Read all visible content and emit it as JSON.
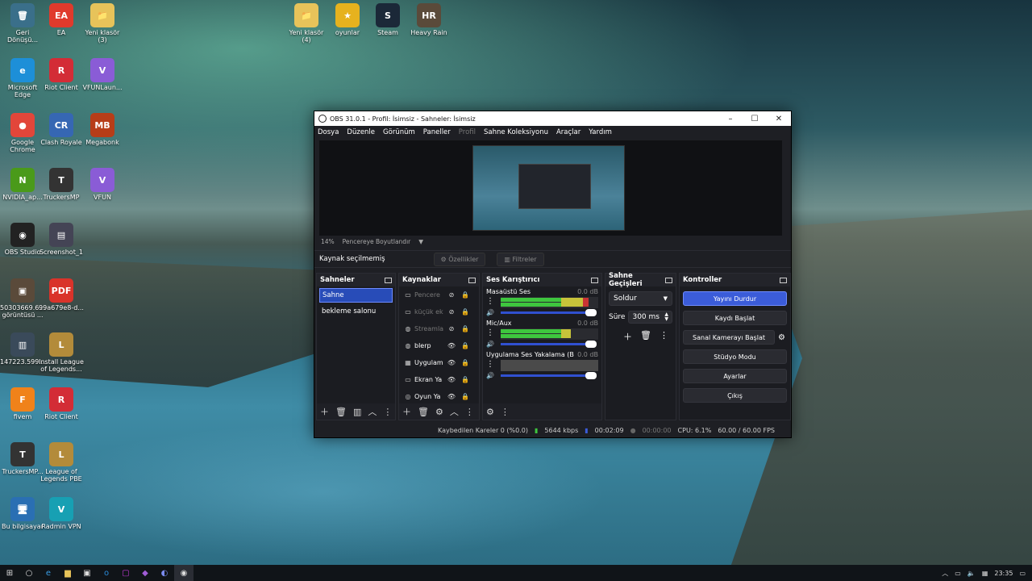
{
  "desktop": {
    "icons": [
      {
        "label": "Geri Dönüşü...",
        "icon": "recycle-bin-icon",
        "glyph": "🗑",
        "bg": "#3a6f8a"
      },
      {
        "label": "EA",
        "icon": "ea-icon",
        "glyph": "EA",
        "bg": "#e03a2c"
      },
      {
        "label": "Yeni klasör (3)",
        "icon": "folder-icon",
        "glyph": "📁",
        "bg": "#e7c35a"
      },
      {
        "label": "Microsoft Edge",
        "icon": "edge-icon",
        "glyph": "e",
        "bg": "#1d8fd8"
      },
      {
        "label": "Riot Client",
        "icon": "riot-icon",
        "glyph": "R",
        "bg": "#d32c36"
      },
      {
        "label": "VFUNLaun...",
        "icon": "vfun-launcher-icon",
        "glyph": "V",
        "bg": "#8a5cd6"
      },
      {
        "label": "Google Chrome",
        "icon": "chrome-icon",
        "glyph": "●",
        "bg": "#e2463a"
      },
      {
        "label": "Clash Royale",
        "icon": "clash-royale-icon",
        "glyph": "CR",
        "bg": "#3667b3"
      },
      {
        "label": "Megabonk",
        "icon": "megabonk-icon",
        "glyph": "MB",
        "bg": "#b73d18"
      },
      {
        "label": "NVIDIA_ap...",
        "icon": "nvidia-icon",
        "glyph": "N",
        "bg": "#4a9a1a"
      },
      {
        "label": "TruckersMP",
        "icon": "truckersmp-icon",
        "glyph": "T",
        "bg": "#333"
      },
      {
        "label": "VFUN",
        "icon": "vfun-icon",
        "glyph": "V",
        "bg": "#8a5cd6"
      },
      {
        "label": "OBS Studio",
        "icon": "obs-icon",
        "glyph": "◉",
        "bg": "#222"
      },
      {
        "label": "Screenshot_1",
        "icon": "screenshot-icon",
        "glyph": "▤",
        "bg": "#445"
      },
      {
        "label": "50303669.6... görüntüsü ...",
        "icon": "image-file-icon",
        "glyph": "▣",
        "bg": "#5a4a3a"
      },
      {
        "label": "99a679e8-d...",
        "icon": "pdf-icon",
        "glyph": "PDF",
        "bg": "#d9332a"
      },
      {
        "label": "147223.599...",
        "icon": "file-icon",
        "glyph": "▥",
        "bg": "#3a4a5a"
      },
      {
        "label": "Install League of Legends...",
        "icon": "league-install-icon",
        "glyph": "L",
        "bg": "#b38b3a"
      },
      {
        "label": "fivem",
        "icon": "fivem-icon",
        "glyph": "F",
        "bg": "#f0821a"
      },
      {
        "label": "Riot Client",
        "icon": "riot-icon",
        "glyph": "R",
        "bg": "#d32c36"
      },
      {
        "label": "TruckersMP...",
        "icon": "truckersmp-icon",
        "glyph": "T",
        "bg": "#333"
      },
      {
        "label": "League of Legends PBE",
        "icon": "league-pbe-icon",
        "glyph": "L",
        "bg": "#b38b3a"
      },
      {
        "label": "Bu bilgisayar",
        "icon": "computer-icon",
        "glyph": "🖥",
        "bg": "#2a6fb3"
      },
      {
        "label": "Radmin VPN",
        "icon": "radmin-vpn-icon",
        "glyph": "V",
        "bg": "#17a0b3"
      },
      {
        "label": "Yeni klasör (4)",
        "icon": "folder-icon",
        "glyph": "📁",
        "bg": "#e7c35a"
      },
      {
        "label": "oyunlar",
        "icon": "star-folder-icon",
        "glyph": "★",
        "bg": "#e6b21e"
      },
      {
        "label": "Steam",
        "icon": "steam-icon",
        "glyph": "S",
        "bg": "#1b2838"
      },
      {
        "label": "Heavy Rain",
        "icon": "heavy-rain-icon",
        "glyph": "HR",
        "bg": "#5a4a3a"
      }
    ]
  },
  "obs": {
    "title": "OBS 31.0.1 - Profil: İsimsiz - Sahneler: İsimsiz",
    "menu": [
      "Dosya",
      "Düzenle",
      "Görünüm",
      "Paneller",
      "Profil",
      "Sahne Koleksiyonu",
      "Araçlar",
      "Yardım"
    ],
    "zoom": "14%",
    "zoom_mode": "Pencereye Boyutlandır",
    "no_source": "Kaynak seçilmemiş",
    "properties_btn": "Özellikler",
    "filters_btn": "Filtreler",
    "docks": {
      "scenes": "Sahneler",
      "sources": "Kaynaklar",
      "mixer": "Ses Karıştırıcı",
      "transitions": "Sahne Geçişleri",
      "controls": "Kontroller"
    },
    "scenes": [
      "Sahne",
      "bekleme salonu"
    ],
    "sources": [
      {
        "name": "Pencere",
        "icon": "window-icon",
        "glyph": "▭",
        "visible": false
      },
      {
        "name": "küçük ek",
        "icon": "window-icon",
        "glyph": "▭",
        "visible": false
      },
      {
        "name": "Streamla",
        "icon": "browser-icon",
        "glyph": "◍",
        "visible": false
      },
      {
        "name": "blerp",
        "icon": "browser-icon",
        "glyph": "◍",
        "visible": true
      },
      {
        "name": "Uygulam",
        "icon": "app-audio-icon",
        "glyph": "▦",
        "visible": true
      },
      {
        "name": "Ekran Ya",
        "icon": "display-icon",
        "glyph": "▭",
        "visible": true
      },
      {
        "name": "Oyun Ya",
        "icon": "game-capture-icon",
        "glyph": "◎",
        "visible": true
      }
    ],
    "mixer": [
      {
        "name": "Masaüstü Ses",
        "db": "0.0 dB",
        "level": 0.9,
        "muted_style": false
      },
      {
        "name": "Mic/Aux",
        "db": "0.0 dB",
        "level": 0.72,
        "muted_style": false
      },
      {
        "name": "Uygulama Ses Yakalama (B",
        "db": "0.0 dB",
        "level": 0.0,
        "muted_style": true
      }
    ],
    "transition": "Soldur",
    "duration_label": "Süre",
    "duration": "300 ms",
    "controls": [
      "Yayını Durdur",
      "Kaydı Başlat",
      "Sanal Kamerayı Başlat",
      "Stüdyo Modu",
      "Ayarlar",
      "Çıkış"
    ],
    "status": {
      "dropped": "Kaybedilen Kareler 0 (%0.0)",
      "bitrate": "5644 kbps",
      "stream_time": "00:02:09",
      "rec_time": "00:00:00",
      "cpu": "CPU: 6.1%",
      "fps": "60.00 / 60.00 FPS"
    }
  },
  "taskbar": {
    "time": "23:35"
  },
  "colors": {
    "accent": "#3b5cd9",
    "meter_green": "#3ec63e",
    "meter_yellow": "#c7c33a",
    "meter_red": "#c93434"
  }
}
